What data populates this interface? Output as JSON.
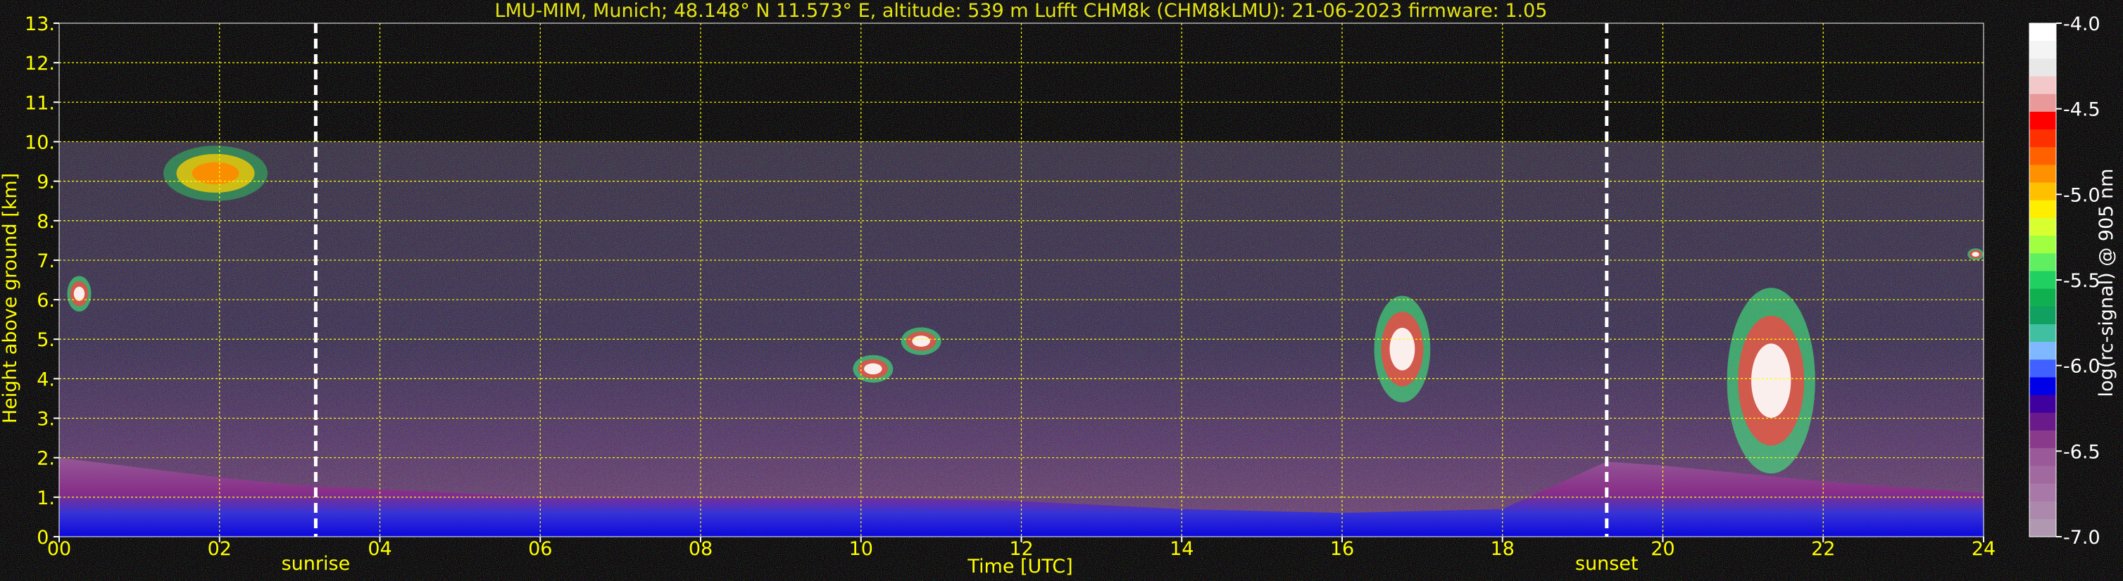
{
  "chart_data": {
    "type": "heatmap",
    "title": "LMU-MIM, Munich; 48.148° N 11.573° E, altitude: 539 m    Lufft CHM8k (CHM8kLMU): 21-06-2023    firmware: 1.05",
    "xlabel": "Time [UTC]",
    "ylabel": "Height above ground [km]",
    "xlim": [
      0,
      24
    ],
    "ylim": [
      0,
      13
    ],
    "x_ticks": [
      "00",
      "02",
      "04",
      "06",
      "08",
      "10",
      "12",
      "14",
      "16",
      "18",
      "20",
      "22",
      "24"
    ],
    "y_ticks": [
      "0.",
      "1.",
      "2.",
      "3.",
      "4.",
      "5.",
      "6.",
      "7.",
      "8.",
      "9.",
      "10.",
      "11.",
      "12.",
      "13."
    ],
    "grid": true,
    "data_top_km": 10,
    "markers": [
      {
        "label": "sunrise",
        "x": 3.2
      },
      {
        "label": "sunset",
        "x": 19.3
      }
    ],
    "colorbar": {
      "label": "log(rc-signal) @ 905 nm",
      "range": [
        -7.0,
        -4.0
      ],
      "ticks": [
        "-4.0",
        "-4.5",
        "-5.0",
        "-5.5",
        "-6.0",
        "-6.5",
        "-7.0"
      ],
      "colors": [
        "#ffffff",
        "#f4f4f4",
        "#e8e8e8",
        "#f2c8c8",
        "#e89a9a",
        "#ff0000",
        "#ff3000",
        "#ff6000",
        "#ff9000",
        "#ffc000",
        "#ffee00",
        "#d8ff30",
        "#a0ff40",
        "#60ef60",
        "#20d060",
        "#10b050",
        "#10a060",
        "#40c0a0",
        "#80b8ff",
        "#4060ff",
        "#0000e8",
        "#4000a0",
        "#6a1a8a",
        "#8a3a8a",
        "#9a5a9a",
        "#a06aa0",
        "#a878a8",
        "#ac88ac",
        "#b098b0"
      ]
    },
    "features": [
      {
        "name": "cirrus",
        "x": [
          1.3,
          2.6
        ],
        "y": [
          8.5,
          9.9
        ]
      },
      {
        "name": "cloud",
        "x": [
          0.1,
          0.4
        ],
        "y": [
          5.7,
          6.6
        ]
      },
      {
        "name": "cloud",
        "x": [
          9.9,
          10.4
        ],
        "y": [
          3.9,
          4.6
        ]
      },
      {
        "name": "cloud",
        "x": [
          10.5,
          11.0
        ],
        "y": [
          4.6,
          5.3
        ]
      },
      {
        "name": "cloud",
        "x": [
          16.4,
          17.1
        ],
        "y": [
          3.4,
          6.1
        ]
      },
      {
        "name": "cloud",
        "x": [
          20.8,
          21.9
        ],
        "y": [
          1.6,
          6.3
        ]
      },
      {
        "name": "cloud",
        "x": [
          23.8,
          24.0
        ],
        "y": [
          7.0,
          7.3
        ]
      }
    ]
  }
}
